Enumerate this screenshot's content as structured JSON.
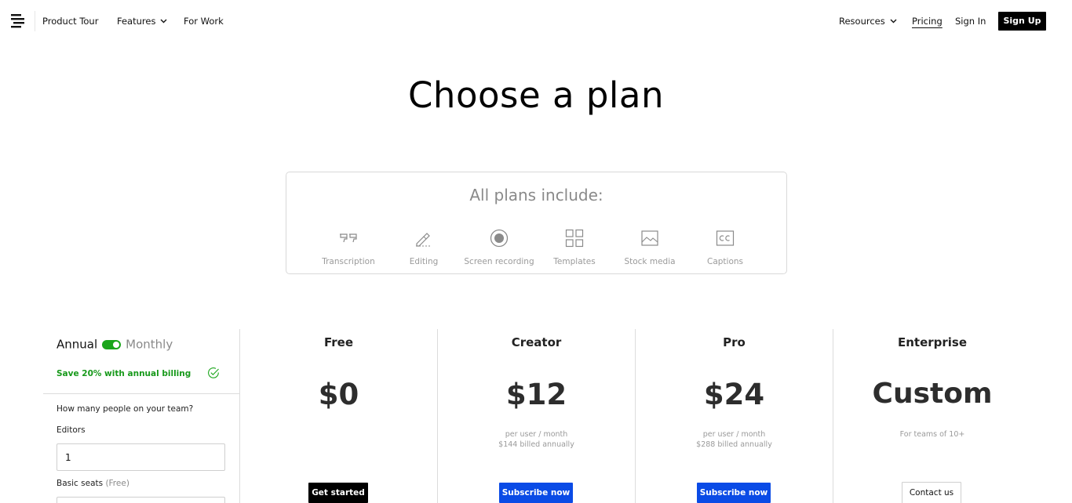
{
  "nav": {
    "logo_icon": "descript-logo-icon",
    "product_tour": "Product Tour",
    "features": "Features",
    "for_work": "For Work",
    "resources": "Resources",
    "pricing": "Pricing",
    "sign_in": "Sign In",
    "sign_up": "Sign Up"
  },
  "page": {
    "title": "Choose a plan"
  },
  "includes": {
    "title": "All plans include:",
    "features": [
      {
        "label": "Transcription",
        "icon": "quote-icon"
      },
      {
        "label": "Editing",
        "icon": "pencil-icon"
      },
      {
        "label": "Screen recording",
        "icon": "record-icon"
      },
      {
        "label": "Templates",
        "icon": "grid-icon"
      },
      {
        "label": "Stock media",
        "icon": "image-icon"
      },
      {
        "label": "Captions",
        "icon": "cc-icon"
      }
    ]
  },
  "billing": {
    "annual_label": "Annual",
    "monthly_label": "Monthly",
    "selected": "Annual",
    "save_text": "Save 20% with annual billing",
    "accent_color": "#1aa51a"
  },
  "team": {
    "question": "How many people on your team?",
    "editors_label": "Editors",
    "editors_value": "1",
    "basic_label": "Basic seats",
    "basic_free": "(Free)"
  },
  "plans": [
    {
      "name": "Free",
      "price": "$0",
      "note1": "",
      "note2": "",
      "button": "Get started"
    },
    {
      "name": "Creator",
      "price": "$12",
      "note1": "per user / month",
      "note2": "$144 billed annually",
      "button": "Subscribe now"
    },
    {
      "name": "Pro",
      "price": "$24",
      "note1": "per user / month",
      "note2": "$288 billed annually",
      "button": "Subscribe now"
    },
    {
      "name": "Enterprise",
      "price": "Custom",
      "note1": "For teams of 10+",
      "note2": "",
      "button": "Contact us"
    }
  ],
  "colors": {
    "primary_button": "#0a4be6",
    "dark_button": "#000000"
  }
}
